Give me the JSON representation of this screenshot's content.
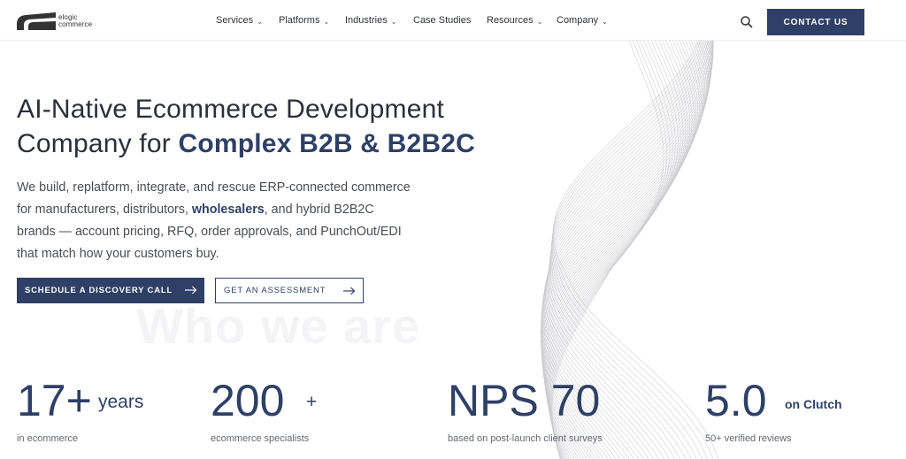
{
  "brand": {
    "line1": "elogic",
    "line2": "commerce"
  },
  "nav": [
    {
      "label": "Services",
      "has_dropdown": true
    },
    {
      "label": "Platforms",
      "has_dropdown": true
    },
    {
      "label": "Industries",
      "has_dropdown": true
    },
    {
      "label": "Case Studies",
      "has_dropdown": false
    },
    {
      "label": "Resources",
      "has_dropdown": true
    },
    {
      "label": "Company",
      "has_dropdown": true
    }
  ],
  "header": {
    "search_icon": "search-icon",
    "contact_label": "CONTACT US"
  },
  "hero": {
    "headline_line1": "AI-Native Ecommerce Development",
    "headline_line2_plain": "Company for ",
    "headline_line2_strong": "Complex B2B & B2B2C",
    "sub_part1": "We build, replatform, integrate, and rescue ERP-connected commerce for manufacturers, distributors, ",
    "sub_bold": "wholesalers",
    "sub_part2": ", and hybrid B2B2C brands — account pricing, RFQ, order approvals, and PunchOut/EDI that match how your customers buy.",
    "primary_cta": "SCHEDULE A DISCOVERY CALL",
    "secondary_cta": "GET AN ASSESSMENT",
    "ghost_heading": "Who we are"
  },
  "stats": [
    {
      "big": "17+",
      "suffix": "years",
      "label": "in ecommerce"
    },
    {
      "big": "200",
      "suffix": "+",
      "label": "ecommerce specialists"
    },
    {
      "big": "NPS 70",
      "suffix": "",
      "label": "based on post-launch client surveys"
    },
    {
      "big": "5.0",
      "suffix": "on Clutch",
      "label": "50+ verified reviews"
    }
  ],
  "colors": {
    "brand_navy": "#2f4066",
    "text": "#2b2f3a",
    "muted": "#656873"
  }
}
